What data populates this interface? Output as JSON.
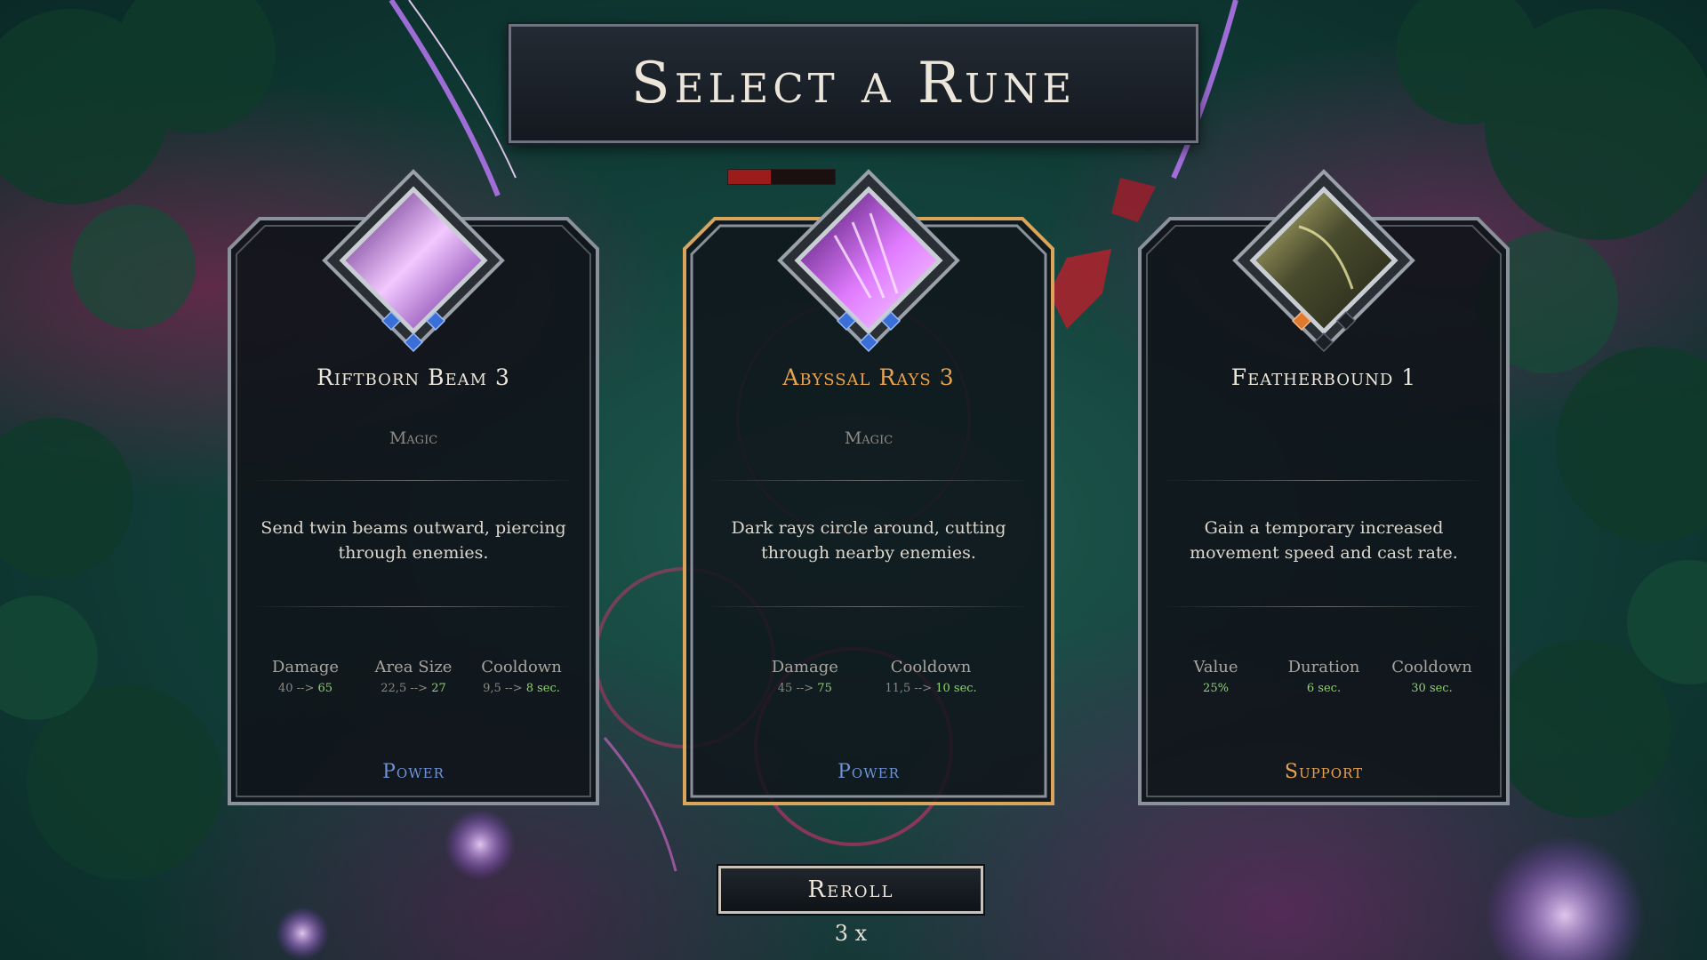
{
  "title": "Select a Rune",
  "cards": [
    {
      "name": "Riftborn Beam 3",
      "type": "Magic",
      "description": "Send twin beams outward, piercing through enemies.",
      "stats": [
        {
          "label": "Damage",
          "old": "40",
          "arrow": "-->",
          "new": "65"
        },
        {
          "label": "Area Size",
          "old": "22,5",
          "arrow": "-->",
          "new": "27"
        },
        {
          "label": "Cooldown",
          "old": "9,5",
          "arrow": "-->",
          "new": "8 sec."
        }
      ],
      "tag": "Power",
      "icon": "violet-beam-rune-icon",
      "gems": [
        "blue",
        "blue",
        "blue"
      ]
    },
    {
      "name": "Abyssal Rays 3",
      "type": "Magic",
      "description": "Dark rays circle around, cutting through nearby enemies.",
      "stats": [
        {
          "label": "Damage",
          "old": "45",
          "arrow": "-->",
          "new": "75"
        },
        {
          "label": "Cooldown",
          "old": "11,5",
          "arrow": "-->",
          "new": "10 sec."
        }
      ],
      "tag": "Power",
      "icon": "violet-rays-rune-icon",
      "gems": [
        "blue",
        "blue",
        "blue"
      ],
      "selected": true
    },
    {
      "name": "Featherbound 1",
      "type": "",
      "description": "Gain a temporary increased movement speed and cast rate.",
      "stats": [
        {
          "label": "Value",
          "new": "25%"
        },
        {
          "label": "Duration",
          "new": "6 sec."
        },
        {
          "label": "Cooldown",
          "new": "30 sec."
        }
      ],
      "tag": "Support",
      "icon": "feather-rune-icon",
      "gems": [
        "orange",
        "empty",
        "empty"
      ]
    }
  ],
  "reroll": {
    "label": "Reroll",
    "count": "3 x"
  },
  "player_health_fraction": 0.4,
  "colors": {
    "accent": "#e8a34e",
    "power": "#6f93d8",
    "stat_new": "#8fd36a",
    "gem_blue": "#3a6fd8",
    "gem_orange": "#e0782e"
  }
}
